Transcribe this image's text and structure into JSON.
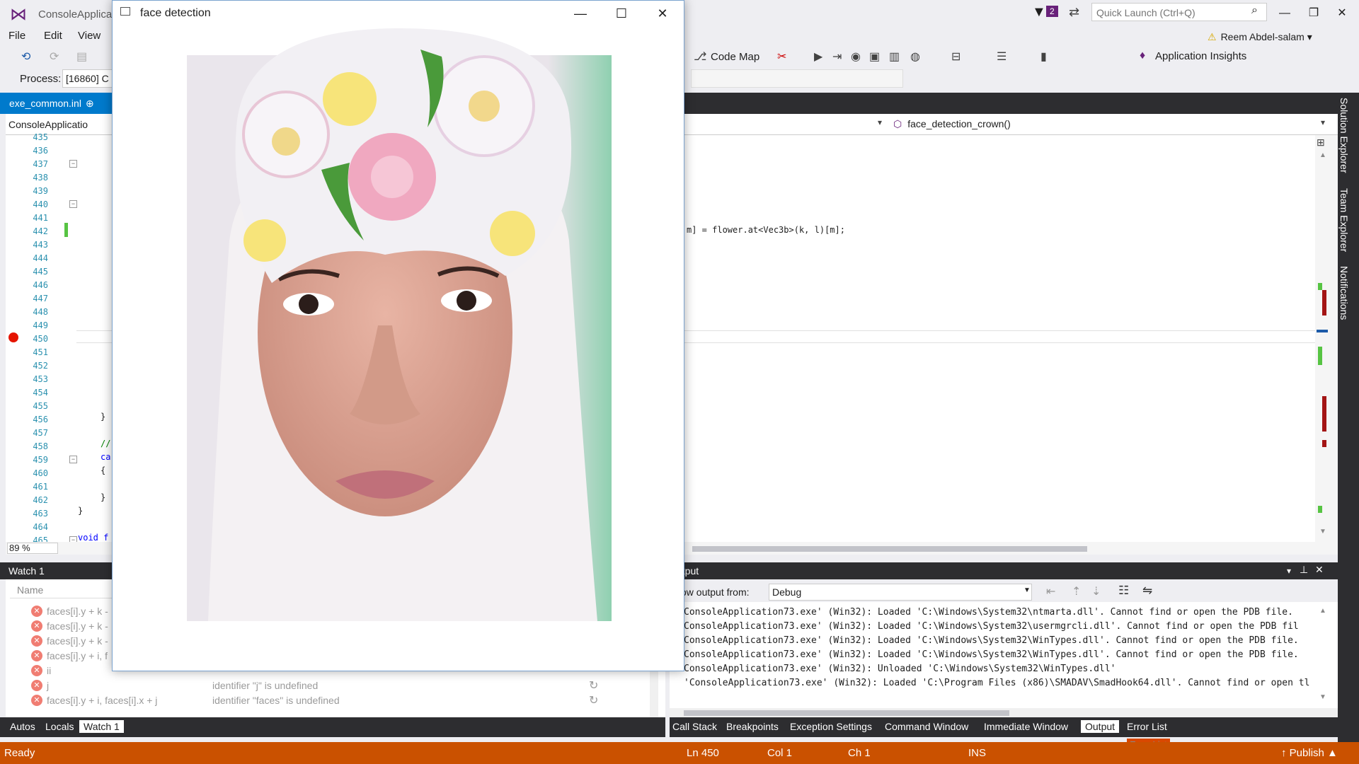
{
  "vs": {
    "app_title": "ConsoleApplica",
    "notification_count": "2",
    "quick_launch_placeholder": "Quick Launch (Ctrl+Q)",
    "user_name": "Reem Abdel-salam",
    "menu": [
      "File",
      "Edit",
      "View"
    ],
    "toolbar": {
      "code_map": "Code Map",
      "app_insights": "Application Insights"
    },
    "process_label": "Process:",
    "process_value": "[16860] C",
    "doc_tab": "exe_common.inl",
    "nav_project": "ConsoleApplicatio",
    "nav_member": "face_detection_crown()",
    "line_numbers": [
      "435",
      "436",
      "437",
      "438",
      "439",
      "440",
      "441",
      "442",
      "443",
      "444",
      "445",
      "446",
      "447",
      "448",
      "449",
      "450",
      "451",
      "452",
      "453",
      "454",
      "455",
      "456",
      "457",
      "458",
      "459",
      "460",
      "461",
      "462",
      "463",
      "464",
      "465"
    ],
    "code_visible": {
      "l442": "m] = flower.at<Vec3b>(k, l)[m];",
      "l456": "}",
      "l458": "//",
      "l459": "ca",
      "l460": "{",
      "l462": "}",
      "l463": "}",
      "l465": "void f"
    },
    "zoom": "89 %",
    "right_tabs": [
      "Solution Explorer",
      "Team Explorer",
      "Notifications"
    ],
    "watch": {
      "title": "Watch 1",
      "col_name": "Name",
      "rows": [
        {
          "name": "faces[i].y + k -",
          "value": ""
        },
        {
          "name": "faces[i].y + k -",
          "value": ""
        },
        {
          "name": "faces[i].y + k -",
          "value": ""
        },
        {
          "name": "faces[i].y + i, f",
          "value": ""
        },
        {
          "name": "ii",
          "value": ""
        },
        {
          "name": "j",
          "value": "identifier \"j\" is undefined"
        },
        {
          "name": "faces[i].y + i, faces[i].x + j",
          "value": "identifier \"faces\" is undefined"
        }
      ],
      "tabs": [
        "Autos",
        "Locals",
        "Watch 1"
      ]
    },
    "output": {
      "title": "utput",
      "show_from_label": "ow output from:",
      "source": "Debug",
      "lines": [
        "ConsoleApplication73.exe' (Win32): Loaded 'C:\\Windows\\System32\\ntmarta.dll'. Cannot find or open the PDB file.",
        "ConsoleApplication73.exe' (Win32): Loaded 'C:\\Windows\\System32\\usermgrcli.dll'. Cannot find or open the PDB fil",
        "ConsoleApplication73.exe' (Win32): Loaded 'C:\\Windows\\System32\\WinTypes.dll'. Cannot find or open the PDB file.",
        "ConsoleApplication73.exe' (Win32): Loaded 'C:\\Windows\\System32\\WinTypes.dll'. Cannot find or open the PDB file.",
        "ConsoleApplication73.exe' (Win32): Unloaded 'C:\\Windows\\System32\\WinTypes.dll'",
        "'ConsoleApplication73.exe' (Win32): Loaded 'C:\\Program Files (x86)\\SMADAV\\SmadHook64.dll'. Cannot find or open tl"
      ],
      "tabs": [
        "Call Stack",
        "Breakpoints",
        "Exception Settings",
        "Command Window",
        "Immediate Window",
        "Output",
        "Error List"
      ],
      "error_list_tooltip": "Error List"
    },
    "status": {
      "ready": "Ready",
      "ln": "Ln 450",
      "col": "Col 1",
      "ch": "Ch 1",
      "ins": "INS",
      "publish": "Publish"
    }
  },
  "face_window": {
    "title": "face detection"
  },
  "colors": {
    "accent": "#007acc",
    "status": "#ca5100",
    "dark": "#2d2d30",
    "breakpoint": "#e51400"
  }
}
